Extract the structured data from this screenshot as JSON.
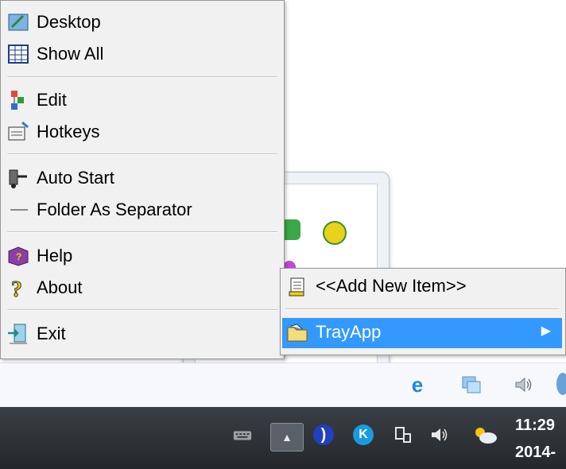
{
  "menu": {
    "items": [
      {
        "label": "Desktop",
        "icon": "desktop-icon"
      },
      {
        "label": "Show All",
        "icon": "grid-icon"
      },
      {
        "label": "Edit",
        "icon": "edit-tree-icon"
      },
      {
        "label": "Hotkeys",
        "icon": "hotkeys-icon"
      },
      {
        "label": "Auto Start",
        "icon": "auto-start-icon"
      },
      {
        "label": "Folder As Separator",
        "icon": "separator-line-icon"
      },
      {
        "label": "Help",
        "icon": "help-book-icon"
      },
      {
        "label": "About",
        "icon": "question-mark-icon"
      },
      {
        "label": "Exit",
        "icon": "exit-door-icon"
      }
    ]
  },
  "submenu": {
    "items": [
      {
        "label": "<<Add New Item>>",
        "icon": "notepad-icon"
      },
      {
        "label": "TrayApp",
        "icon": "folder-icon",
        "selected": true
      }
    ]
  },
  "taskbar": {
    "clock_time": "11:29",
    "clock_date": "2014-"
  },
  "colors": {
    "menu_bg": "#f1f1f1",
    "selection": "#3399ff",
    "taskbar": "#2c3035"
  }
}
